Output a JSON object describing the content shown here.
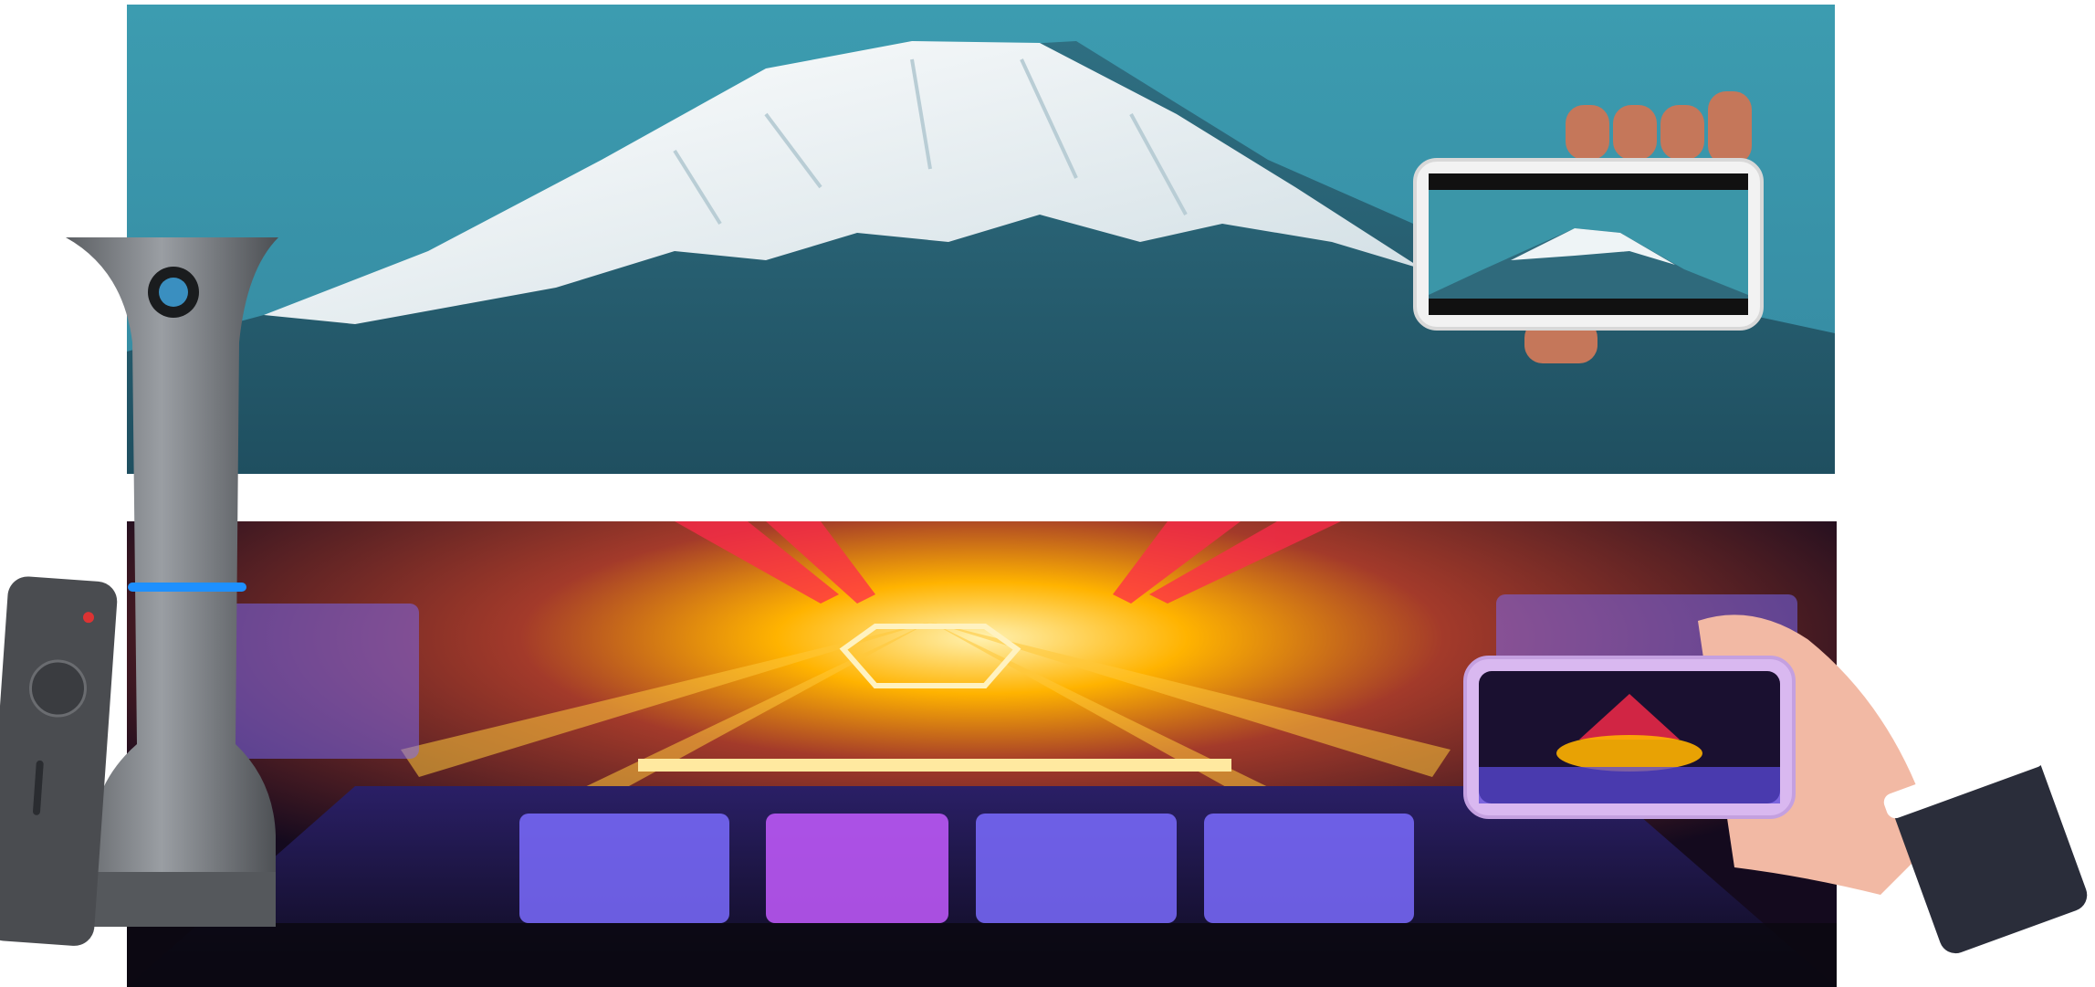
{
  "scene": {
    "panels": [
      {
        "id": "mountain",
        "subject": "snow-capped-mountain",
        "sky_color": "#3b96a8",
        "snow_color": "#eef4f6",
        "slope_color": "#2f6a7c"
      },
      {
        "id": "concert",
        "subject": "arena-concert",
        "stage_light_colors": [
          "#ff2a4a",
          "#ffb300",
          "#6a5cff"
        ]
      }
    ],
    "device": {
      "type": "speaker-camera",
      "body_color": "#6d7074",
      "accent_ring_color": "#1e90ff"
    },
    "remote": {
      "type": "remote-control",
      "color": "#4a4c50"
    },
    "phones": [
      {
        "id": "phone-mountain",
        "frame_color": "#f2f2f2",
        "content": "mountain"
      },
      {
        "id": "phone-concert",
        "frame_color": "#d9b8f0",
        "content": "concert"
      }
    ]
  }
}
